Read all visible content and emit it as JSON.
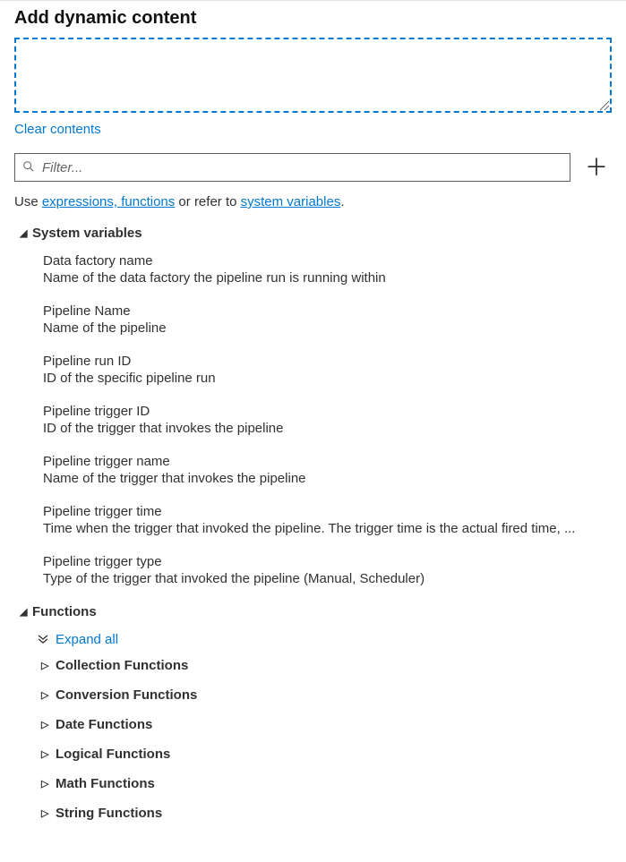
{
  "header": {
    "title": "Add dynamic content"
  },
  "actions": {
    "clear": "Clear contents",
    "filter_placeholder": "Filter..."
  },
  "help": {
    "prefix": "Use ",
    "expressions_link": "expressions, functions",
    "middle": " or refer to ",
    "sysvars_link": "system variables",
    "suffix": "."
  },
  "sections": {
    "system_variables": {
      "label": "System variables",
      "items": [
        {
          "title": "Data factory name",
          "desc": "Name of the data factory the pipeline run is running within"
        },
        {
          "title": "Pipeline Name",
          "desc": "Name of the pipeline"
        },
        {
          "title": "Pipeline run ID",
          "desc": "ID of the specific pipeline run"
        },
        {
          "title": "Pipeline trigger ID",
          "desc": "ID of the trigger that invokes the pipeline"
        },
        {
          "title": "Pipeline trigger name",
          "desc": "Name of the trigger that invokes the pipeline"
        },
        {
          "title": "Pipeline trigger time",
          "desc": "Time when the trigger that invoked the pipeline. The trigger time is the actual fired time, ..."
        },
        {
          "title": "Pipeline trigger type",
          "desc": "Type of the trigger that invoked the pipeline (Manual, Scheduler)"
        }
      ]
    },
    "functions": {
      "label": "Functions",
      "expand_all": "Expand all",
      "groups": [
        "Collection Functions",
        "Conversion Functions",
        "Date Functions",
        "Logical Functions",
        "Math Functions",
        "String Functions"
      ]
    }
  }
}
